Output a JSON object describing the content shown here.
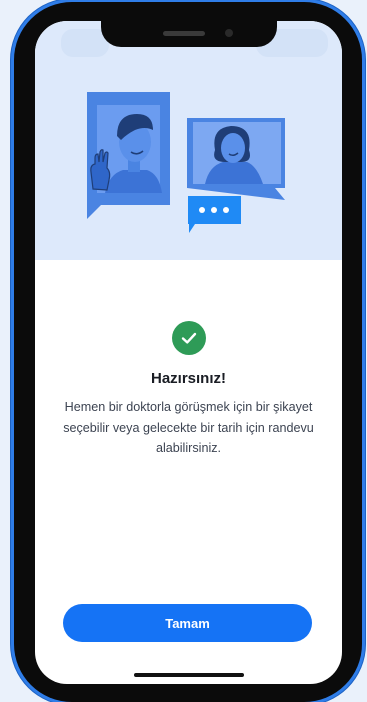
{
  "dialog": {
    "title": "Hazırsınız!",
    "message": "Hemen bir doktorla görüşmek için bir şikayet seçebilir veya gelecekte bir tarih için randevu alabilirsiniz.",
    "confirm_label": "Tamam"
  },
  "icons": {
    "status": "check-circle-icon",
    "chat": "chat-bubble-icon"
  },
  "colors": {
    "accent": "#1573f5",
    "success": "#2e9b57",
    "hero_bg": "#dde9fb",
    "illustration_blue": "#4a84e2"
  }
}
